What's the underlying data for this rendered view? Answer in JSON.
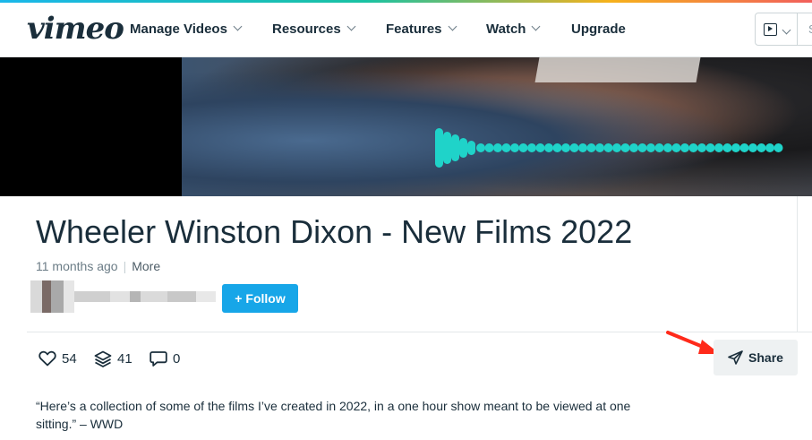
{
  "nav": {
    "logo": "vimeo",
    "items": [
      {
        "label": "Manage Videos",
        "has_menu": true
      },
      {
        "label": "Resources",
        "has_menu": true
      },
      {
        "label": "Features",
        "has_menu": true
      },
      {
        "label": "Watch",
        "has_menu": true
      },
      {
        "label": "Upgrade",
        "has_menu": false
      }
    ],
    "search_partial": "S"
  },
  "video": {
    "title": "Wheeler Winston Dixon - New Films 2022",
    "posted": "11 months ago",
    "separator": "|",
    "more_label": "More",
    "follow_label": "Follow",
    "follow_plus": "+",
    "stats": {
      "likes": "54",
      "collections": "41",
      "comments": "0"
    },
    "share_label": "Share",
    "description": "“Here’s a collection of some of the films I’ve created in 2022, in a one hour show meant to be viewed at one sitting.” – WWD"
  },
  "colors": {
    "accent": "#17a6e8",
    "waveform": "#1fd3c9",
    "annotation_arrow": "#ff2a1a",
    "text": "#1a2e3b",
    "muted": "#6b7c86"
  },
  "icons": {
    "likes": "heart-icon",
    "collections": "layers-icon",
    "comments": "comment-icon",
    "share": "paper-plane-icon",
    "nav_button": "video-icon"
  }
}
